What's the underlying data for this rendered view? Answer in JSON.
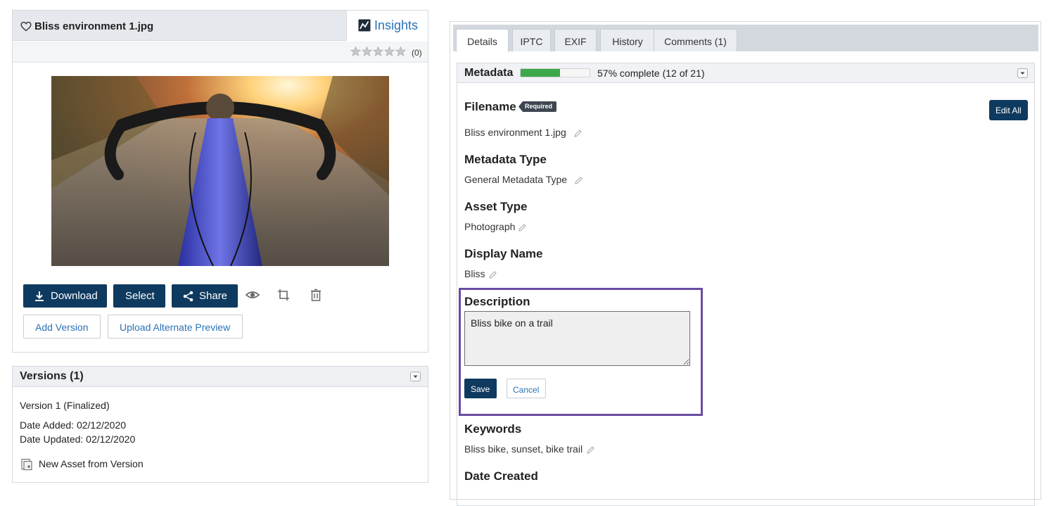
{
  "asset": {
    "title": "Bliss environment 1.jpg",
    "insights_label": "Insights",
    "rating_count": "(0)",
    "rating_stars": 0,
    "actions": {
      "download": "Download",
      "select": "Select",
      "share": "Share",
      "add_version": "Add Version",
      "upload_alternate_preview": "Upload Alternate Preview"
    }
  },
  "versions": {
    "title": "Versions (1)",
    "version_line": "Version 1 (Finalized)",
    "date_added": "Date Added: 02/12/2020",
    "date_updated": "Date Updated: 02/12/2020",
    "new_asset_link": "New Asset from Version"
  },
  "tabs": [
    {
      "label": "Details",
      "active": true
    },
    {
      "label": "IPTC",
      "active": false
    },
    {
      "label": "EXIF",
      "active": false
    },
    {
      "label": "History",
      "active": false
    },
    {
      "label": "Comments (1)",
      "active": false
    }
  ],
  "metadata": {
    "title": "Metadata",
    "progress_fraction": 0.57,
    "progress_text": "57% complete (12 of 21)",
    "edit_all_label": "Edit All",
    "required_badge": "Required",
    "fields": {
      "filename": {
        "label": "Filename",
        "value": "Bliss environment 1.jpg"
      },
      "metadata_type": {
        "label": "Metadata Type",
        "value": "General Metadata Type"
      },
      "asset_type": {
        "label": "Asset Type",
        "value": "Photograph"
      },
      "display_name": {
        "label": "Display Name",
        "value": "Bliss"
      },
      "description": {
        "label": "Description",
        "value": "Bliss bike on a trail",
        "save_label": "Save",
        "cancel_label": "Cancel"
      },
      "keywords": {
        "label": "Keywords",
        "value": "Bliss bike, sunset, bike trail"
      },
      "date_created": {
        "label": "Date Created"
      }
    }
  },
  "colors": {
    "primary_button": "#0e3a5f",
    "link": "#2a73b6",
    "progress": "#3da84b",
    "focus_outline": "#6a4da0"
  }
}
